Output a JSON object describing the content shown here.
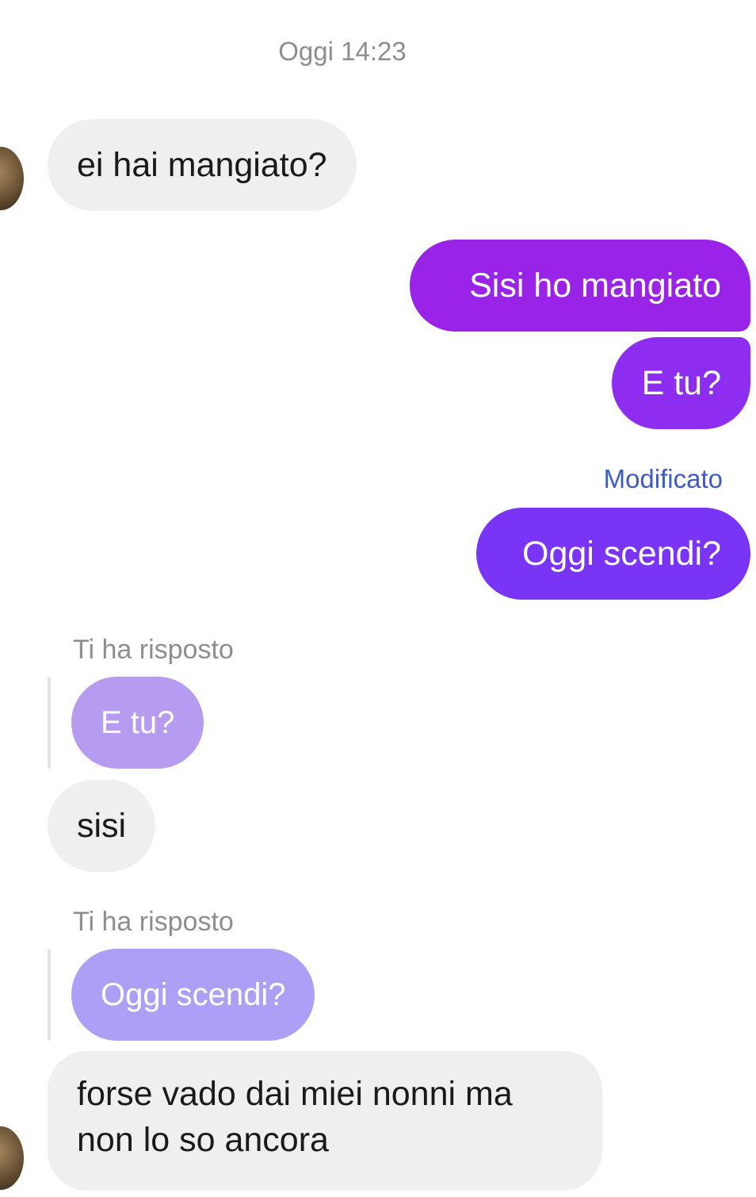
{
  "timestamp": "Oggi 14:23",
  "messages": {
    "m1": "ei hai mangiato?",
    "m2": "Sisi ho mangiato",
    "m3": "E tu?",
    "edited": "Modificato",
    "m4": "Oggi scendi?",
    "reply1_label": "Ti ha risposto",
    "reply1_quote": "E tu?",
    "m5": "sisi",
    "reply2_label": "Ti ha risposto",
    "reply2_quote": "Oggi scendi?",
    "m6_line1": "forse vado dai miei nonni ma",
    "m6_line2": "non lo so ancora"
  },
  "colors": {
    "incoming_bg": "#efefef",
    "outgoing_top": "#9b22e6",
    "outgoing_bottom": "#7a34f6",
    "quote1": "#b69cf0",
    "quote2": "#ad9ff5",
    "edited_text": "#3d5ac8"
  }
}
